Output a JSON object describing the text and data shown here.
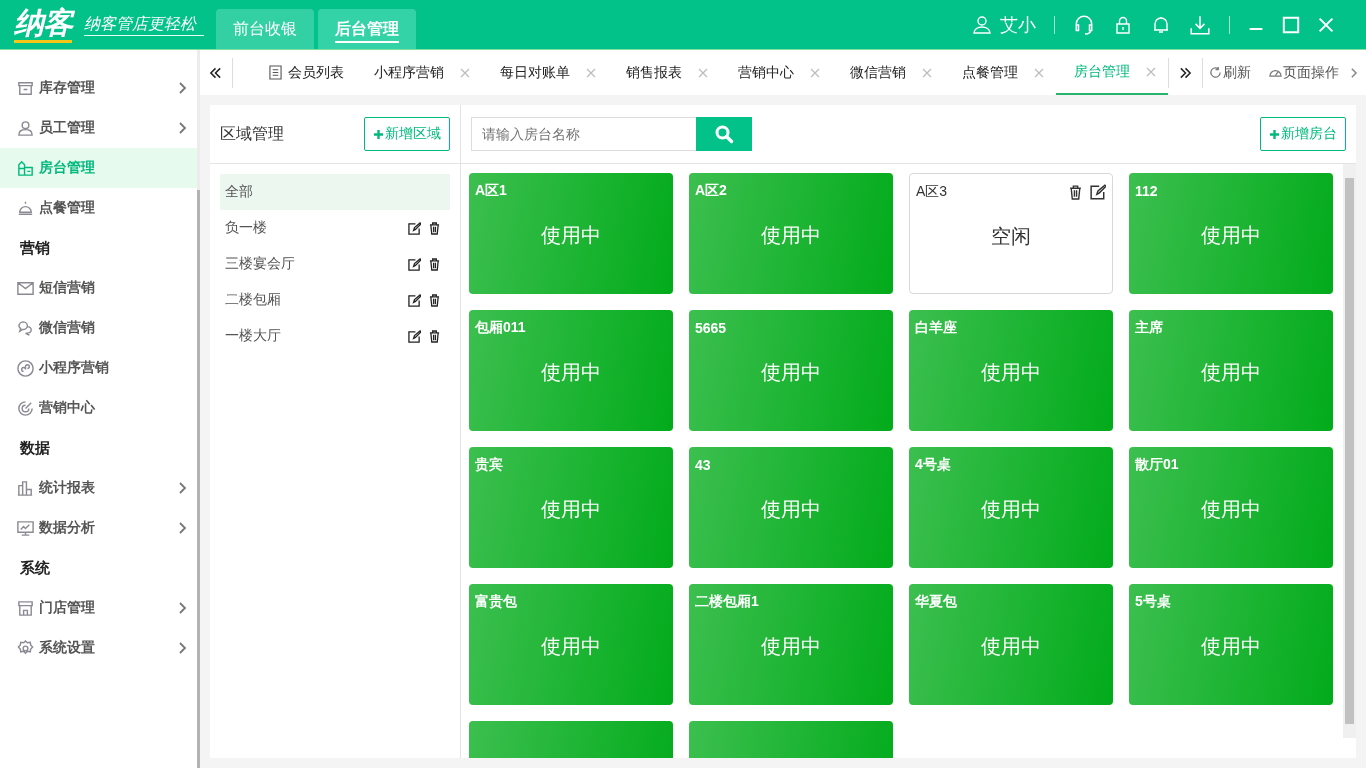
{
  "header": {
    "logo": "纳客",
    "slogan": "纳客管店更轻松",
    "modes": [
      {
        "label": "前台收银",
        "selected": false
      },
      {
        "label": "后台管理",
        "selected": true
      }
    ],
    "user": "艾小"
  },
  "sidebar": {
    "items": [
      {
        "kind": "item",
        "label": "库存管理",
        "expandable": true,
        "selected": false
      },
      {
        "kind": "item",
        "label": "员工管理",
        "expandable": true,
        "selected": false
      },
      {
        "kind": "item",
        "label": "房台管理",
        "expandable": false,
        "selected": true
      },
      {
        "kind": "item",
        "label": "点餐管理",
        "expandable": false,
        "selected": false
      },
      {
        "kind": "section",
        "label": "营销"
      },
      {
        "kind": "item",
        "label": "短信营销",
        "expandable": false,
        "selected": false
      },
      {
        "kind": "item",
        "label": "微信营销",
        "expandable": false,
        "selected": false
      },
      {
        "kind": "item",
        "label": "小程序营销",
        "expandable": false,
        "selected": false
      },
      {
        "kind": "item",
        "label": "营销中心",
        "expandable": false,
        "selected": false
      },
      {
        "kind": "section",
        "label": "数据"
      },
      {
        "kind": "item",
        "label": "统计报表",
        "expandable": true,
        "selected": false
      },
      {
        "kind": "item",
        "label": "数据分析",
        "expandable": true,
        "selected": false
      },
      {
        "kind": "section",
        "label": "系统"
      },
      {
        "kind": "item",
        "label": "门店管理",
        "expandable": true,
        "selected": false
      },
      {
        "kind": "item",
        "label": "系统设置",
        "expandable": true,
        "selected": false
      }
    ]
  },
  "tabs": [
    {
      "label": "会员列表",
      "closable": false,
      "selected": false
    },
    {
      "label": "小程序营销",
      "closable": true,
      "selected": false
    },
    {
      "label": "每日对账单",
      "closable": true,
      "selected": false
    },
    {
      "label": "销售报表",
      "closable": true,
      "selected": false
    },
    {
      "label": "营销中心",
      "closable": true,
      "selected": false
    },
    {
      "label": "微信营销",
      "closable": true,
      "selected": false
    },
    {
      "label": "点餐管理",
      "closable": true,
      "selected": false
    },
    {
      "label": "房台管理",
      "closable": true,
      "selected": true
    }
  ],
  "tab_actions": {
    "refresh": "刷新",
    "page_ops": "页面操作"
  },
  "areas": {
    "title": "区域管理",
    "add_button": "新增区域",
    "items": [
      {
        "label": "全部",
        "selected": true,
        "editable": false
      },
      {
        "label": "负一楼",
        "selected": false,
        "editable": true
      },
      {
        "label": "三楼宴会厅",
        "selected": false,
        "editable": true
      },
      {
        "label": "二楼包厢",
        "selected": false,
        "editable": true
      },
      {
        "label": "一楼大厅",
        "selected": false,
        "editable": true
      }
    ]
  },
  "rooms": {
    "search_placeholder": "请输入房台名称",
    "add_button": "新增房台",
    "cards": [
      {
        "name": "A区1",
        "kind": "busy",
        "label": "使用中"
      },
      {
        "name": "A区2",
        "kind": "busy",
        "label": "使用中"
      },
      {
        "name": "A区3",
        "kind": "idle",
        "label": "空闲"
      },
      {
        "name": "112",
        "kind": "busy",
        "label": "使用中"
      },
      {
        "name": "包厢011",
        "kind": "busy",
        "label": "使用中"
      },
      {
        "name": "5665",
        "kind": "busy",
        "label": "使用中"
      },
      {
        "name": "白羊座",
        "kind": "busy",
        "label": "使用中"
      },
      {
        "name": "主席",
        "kind": "busy",
        "label": "使用中"
      },
      {
        "name": "贵宾",
        "kind": "busy",
        "label": "使用中"
      },
      {
        "name": "43",
        "kind": "busy",
        "label": "使用中"
      },
      {
        "name": "4号桌",
        "kind": "busy",
        "label": "使用中"
      },
      {
        "name": "散厅01",
        "kind": "busy",
        "label": "使用中"
      },
      {
        "name": "富贵包",
        "kind": "busy",
        "label": "使用中"
      },
      {
        "name": "二楼包厢1",
        "kind": "busy",
        "label": "使用中"
      },
      {
        "name": "华夏包",
        "kind": "busy",
        "label": "使用中"
      },
      {
        "name": "5号桌",
        "kind": "busy",
        "label": "使用中"
      },
      {
        "kind": "busy"
      },
      {
        "kind": "busy"
      }
    ]
  }
}
